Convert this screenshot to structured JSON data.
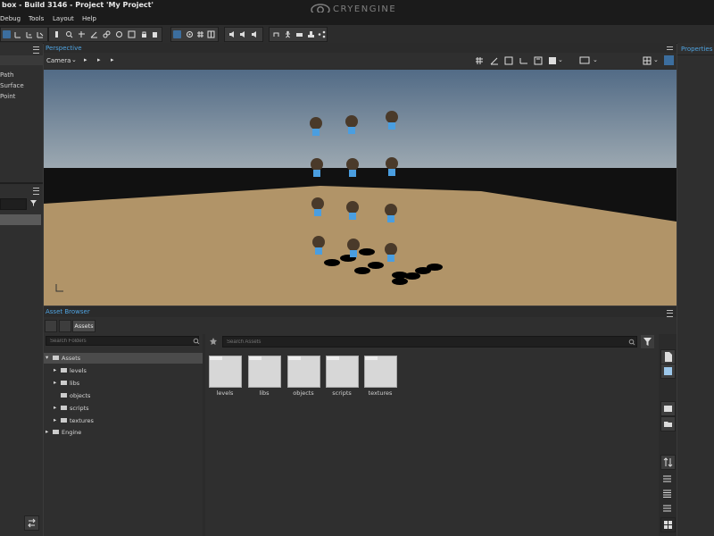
{
  "window": {
    "title": "box - Build 3146 - Project 'My Project'",
    "logo_text": "CRYENGINE"
  },
  "menu": [
    "Debug",
    "Tools",
    "Layout",
    "Help"
  ],
  "left_panel": {
    "items": [
      "Path",
      "Surface",
      "Point"
    ],
    "search_placeholder": ""
  },
  "viewport": {
    "title": "Perspective",
    "camera_label": "Camera"
  },
  "properties": {
    "title": "Properties"
  },
  "asset_browser": {
    "title": "Asset Browser",
    "breadcrumb": "Assets",
    "search_folders_placeholder": "Search Folders",
    "search_assets_placeholder": "Search Assets",
    "tree": [
      {
        "label": "Assets",
        "expanded": true
      },
      {
        "label": "levels",
        "expanded": false
      },
      {
        "label": "libs",
        "expanded": false
      },
      {
        "label": "objects",
        "expanded": false
      },
      {
        "label": "scripts",
        "expanded": false
      },
      {
        "label": "textures",
        "expanded": false
      },
      {
        "label": "Engine",
        "expanded": false
      }
    ],
    "folders": [
      "levels",
      "libs",
      "objects",
      "scripts",
      "textures"
    ]
  },
  "colors": {
    "accent": "#4fa3e0",
    "active_tool": "#3c6e9e",
    "terrain": "#b19468",
    "sky_top": "#526b86"
  }
}
